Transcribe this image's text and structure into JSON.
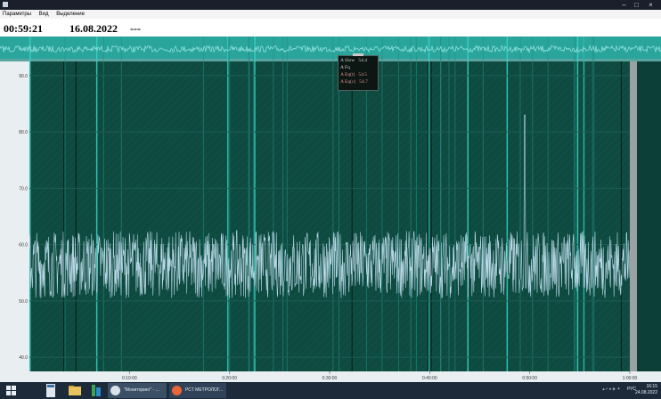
{
  "window": {
    "minimize_icon": "minimize-icon",
    "maximize_icon": "maximize-icon",
    "close_icon": "close-icon"
  },
  "menu": {
    "items": [
      "Параметры",
      "Вид",
      "Выделение"
    ]
  },
  "status": {
    "time": "00:59:21",
    "date": "16.08.2022",
    "mode": "---"
  },
  "legend": {
    "rows": [
      {
        "label": "A Slow",
        "value": "54.4"
      },
      {
        "label": "A Fq",
        "value": ""
      },
      {
        "label": "A Eq(t)",
        "value": "54.5"
      },
      {
        "label": "A Eq(c)",
        "value": "54.7"
      }
    ]
  },
  "chart_data": {
    "type": "line",
    "title": "",
    "y_ticks": [
      "90.0",
      "80.0",
      "70.0",
      "60.0",
      "50.0",
      "40.0"
    ],
    "x_ticks": [
      "0:10:00",
      "0:20:00",
      "0:30:00",
      "0:40:00",
      "0:50:00",
      "1:00:00"
    ],
    "ylim": [
      37.5,
      92.5
    ],
    "xlim_minutes": [
      0,
      60
    ],
    "series": [
      {
        "name": "A Slow",
        "color": "#b8d8e6",
        "baseline": 56.5,
        "noise": 6.0,
        "peak": {
          "x": 49.5,
          "y": 83.0
        }
      }
    ],
    "overview_color": "#8fe0dd",
    "background": "#0e4a40",
    "grid_color": "#1d5e54"
  },
  "taskbar": {
    "apps": [
      {
        "label": "\"Мониторинг\" - ...",
        "icon": "monitor-app-icon"
      },
      {
        "label": "РСТ МЕТРОЛОГ...",
        "icon": "browser-icon"
      }
    ],
    "tray_text": "РУС",
    "clock_time": "16:15",
    "clock_date": "24.08.2022"
  }
}
